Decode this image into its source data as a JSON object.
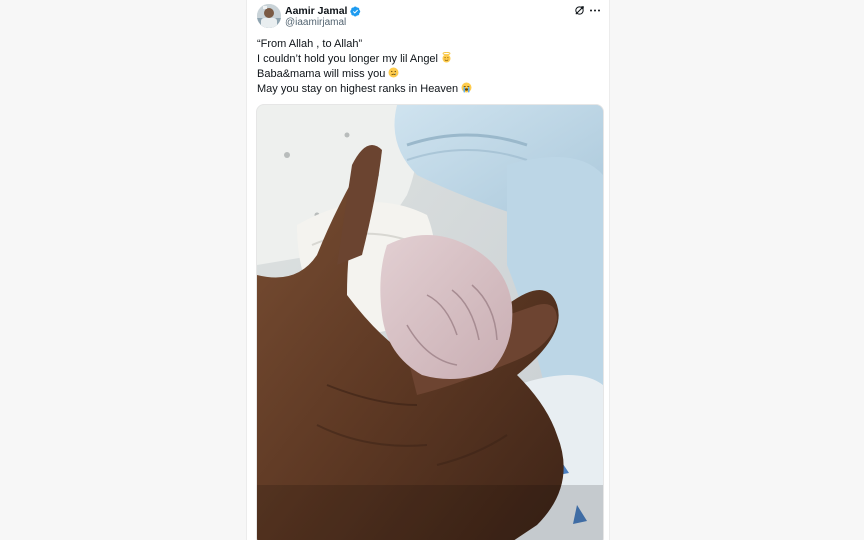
{
  "author": {
    "display_name": "Aamir Jamal",
    "handle": "@iaamirjamal",
    "verified": true,
    "avatar_icon": "avatar-photo"
  },
  "actions": {
    "grok_icon": "grok-icon",
    "more_icon": "more-options-icon"
  },
  "tweet": {
    "lines": [
      "“From Allah , to Allah”",
      "I couldn’t hold you longer my lil Angel",
      "Baba&mama will miss you",
      "May you stay on highest ranks in Heaven"
    ],
    "emojis": [
      "",
      "angel-emoji",
      "crying-emoji",
      "loudly-crying-emoji"
    ]
  },
  "media": {
    "type": "photo"
  },
  "colors": {
    "text": "#0f1419",
    "secondary": "#536471",
    "verified": "#1d9bf0"
  }
}
